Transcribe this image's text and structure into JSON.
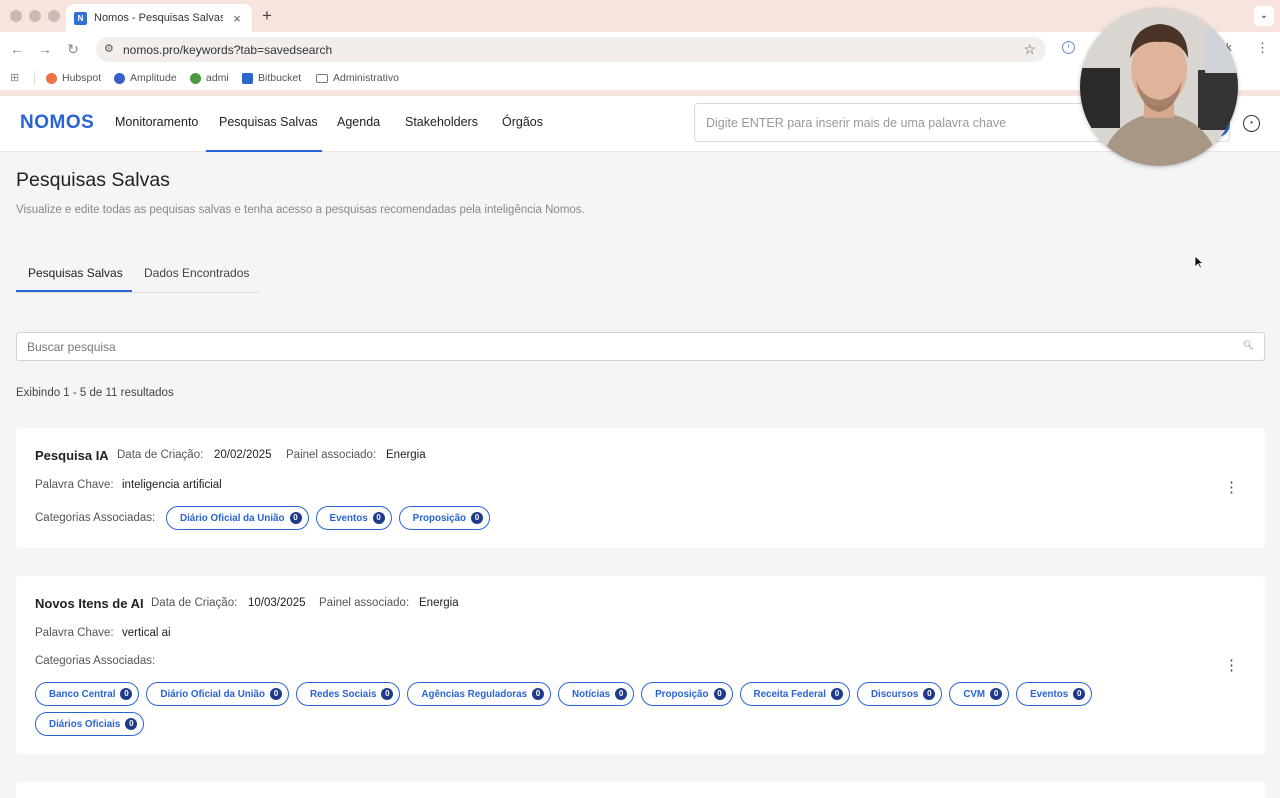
{
  "browser": {
    "tab_title": "Nomos - Pesquisas Salvas",
    "url": "nomos.pro/keywords?tab=savedsearch",
    "extension_partial_label": "k",
    "bookmarks": [
      {
        "label": "Hubspot",
        "icon": "hubspot-icon"
      },
      {
        "label": "Amplitude",
        "icon": "amplitude-icon"
      },
      {
        "label": "admi",
        "icon": "admi-icon"
      },
      {
        "label": "Bitbucket",
        "icon": "bitbucket-icon"
      },
      {
        "label": "Administrativo",
        "icon": "folder-icon"
      }
    ]
  },
  "header": {
    "logo": "NOMOS",
    "nav": [
      "Monitoramento",
      "Pesquisas Salvas",
      "Agenda",
      "Stakeholders",
      "Órgãos"
    ],
    "active_nav": "Pesquisas Salvas",
    "search_placeholder": "Digite ENTER para inserir mais de uma palavra chave"
  },
  "page": {
    "title": "Pesquisas Salvas",
    "subtitle": "Visualize e edite todas as pequisas salvas e tenha acesso a pesquisas recomendadas pela inteligência Nomos.",
    "tabs": [
      "Pesquisas Salvas",
      "Dados Encontrados"
    ],
    "active_tab": "Pesquisas Salvas",
    "filter_placeholder": "Buscar pesquisa",
    "results_text": "Exibindo 1 - 5 de 11 resultados"
  },
  "labels": {
    "created": "Data de Criação:",
    "panel": "Painel associado:",
    "keyword": "Palavra Chave:",
    "categories": "Categorias Associadas:"
  },
  "searches": [
    {
      "name": "Pesquisa IA",
      "created": "20/02/2025",
      "panel": "Energia",
      "keyword": "inteligencia artificial",
      "categories": [
        {
          "label": "Diário Oficial da União",
          "count": "0"
        },
        {
          "label": "Eventos",
          "count": "0"
        },
        {
          "label": "Proposição",
          "count": "0"
        }
      ]
    },
    {
      "name": "Novos Itens de AI",
      "created": "10/03/2025",
      "panel": "Energia",
      "keyword": "vertical ai",
      "categories": [
        {
          "label": "Banco Central",
          "count": "0"
        },
        {
          "label": "Diário Oficial da União",
          "count": "0"
        },
        {
          "label": "Redes Sociais",
          "count": "0"
        },
        {
          "label": "Agências Reguladoras",
          "count": "0"
        },
        {
          "label": "Notícias",
          "count": "0"
        },
        {
          "label": "Proposição",
          "count": "0"
        },
        {
          "label": "Receita Federal",
          "count": "0"
        },
        {
          "label": "Discursos",
          "count": "0"
        },
        {
          "label": "CVM",
          "count": "0"
        },
        {
          "label": "Eventos",
          "count": "0"
        },
        {
          "label": "Diários Oficiais",
          "count": "0"
        }
      ]
    }
  ],
  "colors": {
    "brand": "#2a64d4",
    "chip_count_bg": "#1e3a8a",
    "chrome_bg": "#f7e4df"
  }
}
